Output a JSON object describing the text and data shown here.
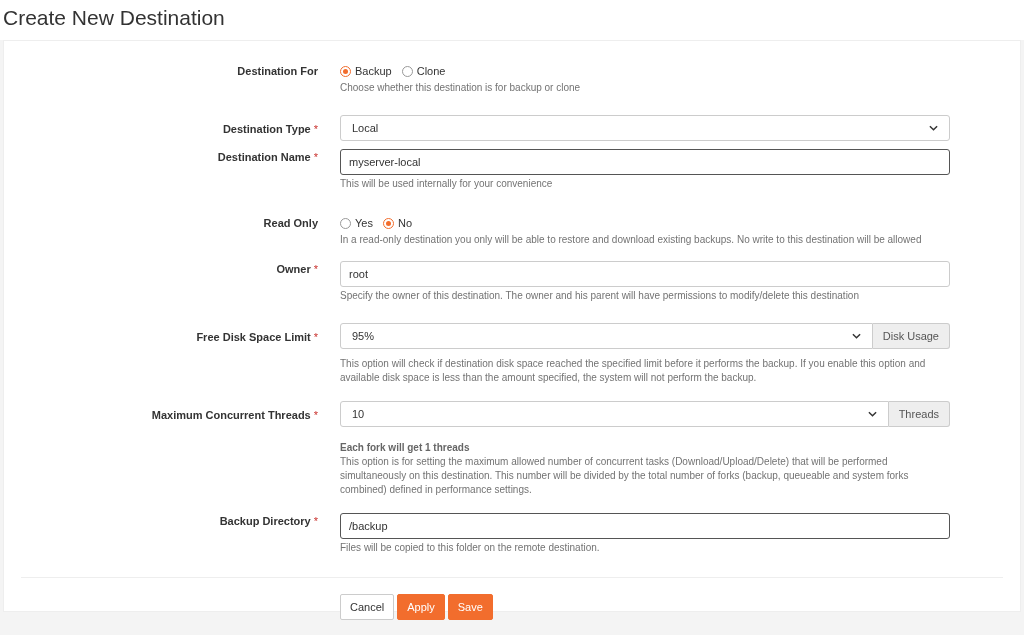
{
  "page_title": "Create New Destination",
  "fields": [
    {
      "kind": "radio",
      "label": "Destination For",
      "options": [
        {
          "label": "Backup",
          "selected": true
        },
        {
          "label": "Clone",
          "selected": false
        }
      ],
      "help": "Choose whether this destination is for backup or clone"
    },
    {
      "kind": "select",
      "label": "Destination Type",
      "required_mark": "*",
      "value": "Local"
    },
    {
      "kind": "text",
      "label": "Destination Name",
      "required_mark": "*",
      "value": "myserver-local",
      "focused": true,
      "help": "This will be used internally for your convenience"
    },
    {
      "kind": "radio",
      "label": "Read Only",
      "options": [
        {
          "label": "Yes",
          "selected": false
        },
        {
          "label": "No",
          "selected": true
        }
      ],
      "help": "In a read-only destination you only will be able to restore and download existing backups. No write to this destination will be allowed"
    },
    {
      "kind": "text",
      "label": "Owner",
      "required_mark": "*",
      "value": "root",
      "focused": false,
      "help": "Specify the owner of this destination. The owner and his parent will have permissions to modify/delete this destination"
    },
    {
      "kind": "select_addon",
      "label": "Free Disk Space Limit",
      "required_mark": "*",
      "value": "95%",
      "addon": "Disk Usage",
      "help": "This option will check if destination disk space reached the specified limit before it performs the backup. If you enable this option and available disk space is less than the amount specified, the system will not perform the backup."
    },
    {
      "kind": "select_addon",
      "label": "Maximum Concurrent Threads",
      "required_mark": "*",
      "value": "10",
      "addon": "Threads",
      "note": "Each fork will get 1 threads",
      "help": "This option is for setting the maximum allowed number of concurrent tasks (Download/Upload/Delete) that will be performed simultaneously on this destination. This number will be divided by the total number of forks (backup, queueable and system forks combined) defined in performance settings."
    },
    {
      "kind": "text",
      "label": "Backup Directory",
      "required_mark": "*",
      "value": "/backup",
      "focused": true,
      "help": "Files will be copied to this folder on the remote destination."
    }
  ],
  "buttons": [
    {
      "label": "Cancel",
      "kind": "secondary"
    },
    {
      "label": "Apply",
      "kind": "primary"
    },
    {
      "label": "Save",
      "kind": "primary"
    }
  ]
}
